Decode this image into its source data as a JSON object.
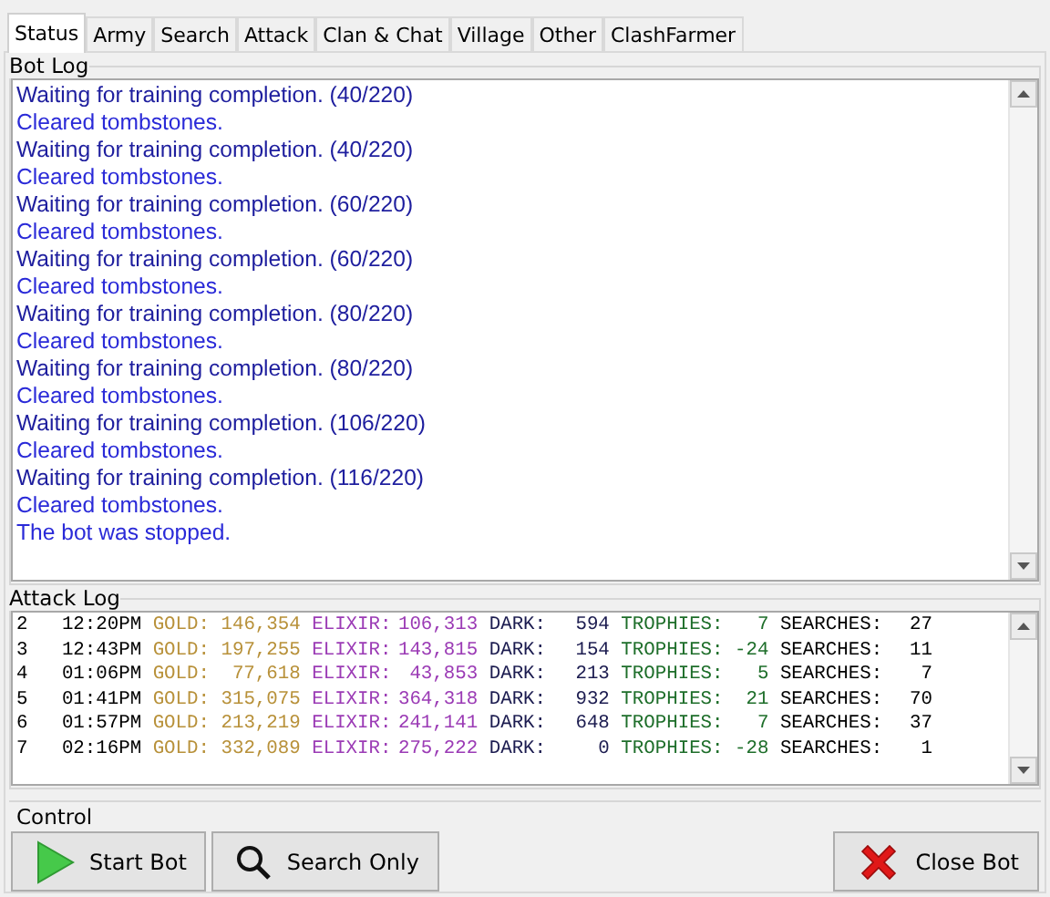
{
  "tabs": [
    {
      "label": "Status",
      "selected": true
    },
    {
      "label": "Army",
      "selected": false
    },
    {
      "label": "Search",
      "selected": false
    },
    {
      "label": "Attack",
      "selected": false
    },
    {
      "label": "Clan & Chat",
      "selected": false
    },
    {
      "label": "Village",
      "selected": false
    },
    {
      "label": "Other",
      "selected": false
    },
    {
      "label": "ClashFarmer",
      "selected": false
    }
  ],
  "bot_log": {
    "title": "Bot Log",
    "lines": [
      {
        "text": "Waiting for training completion. (40/220)",
        "color": "#1e1e9e"
      },
      {
        "text": "Cleared tombstones.",
        "color": "#2a2ad8"
      },
      {
        "text": "Waiting for training completion. (40/220)",
        "color": "#1e1e9e"
      },
      {
        "text": "Cleared tombstones.",
        "color": "#2a2ad8"
      },
      {
        "text": "Waiting for training completion. (60/220)",
        "color": "#1e1e9e"
      },
      {
        "text": "Cleared tombstones.",
        "color": "#2a2ad8"
      },
      {
        "text": "Waiting for training completion. (60/220)",
        "color": "#1e1e9e"
      },
      {
        "text": "Cleared tombstones.",
        "color": "#2a2ad8"
      },
      {
        "text": "Waiting for training completion. (80/220)",
        "color": "#1e1e9e"
      },
      {
        "text": "Cleared tombstones.",
        "color": "#2a2ad8"
      },
      {
        "text": "Waiting for training completion. (80/220)",
        "color": "#1e1e9e"
      },
      {
        "text": "Cleared tombstones.",
        "color": "#2a2ad8"
      },
      {
        "text": "Waiting for training completion. (106/220)",
        "color": "#1e1e9e"
      },
      {
        "text": "Cleared tombstones.",
        "color": "#2a2ad8"
      },
      {
        "text": "Waiting for training completion. (116/220)",
        "color": "#1e1e9e"
      },
      {
        "text": "Cleared tombstones.",
        "color": "#2a2ad8"
      },
      {
        "text": "The bot was stopped.",
        "color": "#2a2ad8"
      }
    ]
  },
  "attack_log": {
    "title": "Attack Log",
    "rows": [
      {
        "number": "2",
        "time": "12:20PM",
        "gold_label": "GOLD:",
        "gold": "146,354",
        "elixir_label": "ELIXIR:",
        "elixir": "106,313",
        "dark_label": "DARK:",
        "dark": "594",
        "trophies_label": "TROPHIES:",
        "trophies": "7",
        "searches_label": "SEARCHES:",
        "searches": "27"
      },
      {
        "number": "3",
        "time": "12:43PM",
        "gold_label": "GOLD:",
        "gold": "197,255",
        "elixir_label": "ELIXIR:",
        "elixir": "143,815",
        "dark_label": "DARK:",
        "dark": "154",
        "trophies_label": "TROPHIES:",
        "trophies": "-24",
        "searches_label": "SEARCHES:",
        "searches": "11"
      },
      {
        "number": "4",
        "time": "01:06PM",
        "gold_label": "GOLD:",
        "gold": "77,618",
        "elixir_label": "ELIXIR:",
        "elixir": "43,853",
        "dark_label": "DARK:",
        "dark": "213",
        "trophies_label": "TROPHIES:",
        "trophies": "5",
        "searches_label": "SEARCHES:",
        "searches": "7"
      },
      {
        "number": "5",
        "time": "01:41PM",
        "gold_label": "GOLD:",
        "gold": "315,075",
        "elixir_label": "ELIXIR:",
        "elixir": "364,318",
        "dark_label": "DARK:",
        "dark": "932",
        "trophies_label": "TROPHIES:",
        "trophies": "21",
        "searches_label": "SEARCHES:",
        "searches": "70"
      },
      {
        "number": "6",
        "time": "01:57PM",
        "gold_label": "GOLD:",
        "gold": "213,219",
        "elixir_label": "ELIXIR:",
        "elixir": "241,141",
        "dark_label": "DARK:",
        "dark": "648",
        "trophies_label": "TROPHIES:",
        "trophies": "7",
        "searches_label": "SEARCHES:",
        "searches": "37"
      },
      {
        "number": "7",
        "time": "02:16PM",
        "gold_label": "GOLD:",
        "gold": "332,089",
        "elixir_label": "ELIXIR:",
        "elixir": "275,222",
        "dark_label": "DARK:",
        "dark": "0",
        "trophies_label": "TROPHIES:",
        "trophies": "-28",
        "searches_label": "SEARCHES:",
        "searches": "1"
      }
    ]
  },
  "control": {
    "title": "Control",
    "buttons": [
      {
        "label": "Start Bot",
        "kind": "start"
      },
      {
        "label": "Search Only",
        "kind": "search"
      },
      {
        "label": "Close Bot",
        "kind": "close"
      }
    ]
  }
}
